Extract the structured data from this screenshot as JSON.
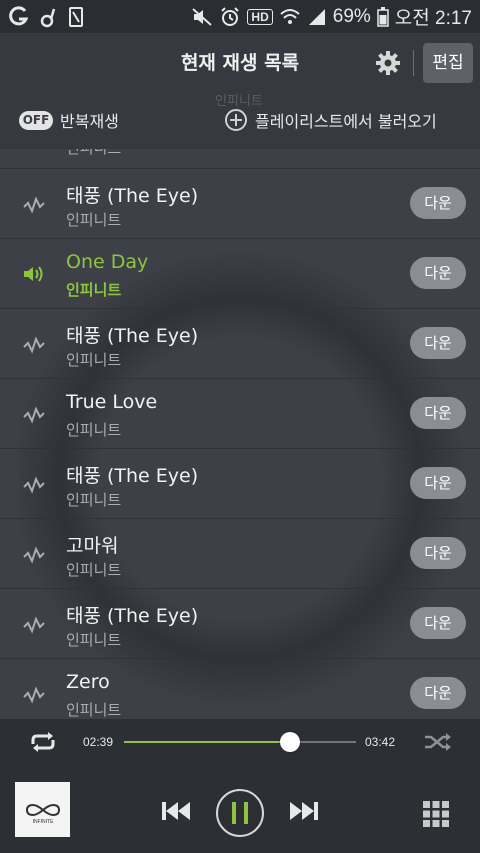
{
  "status_bar": {
    "battery": "69%",
    "time": "오전 2:17",
    "hd_label": "HD"
  },
  "header": {
    "title": "현재 재생 목록",
    "edit_label": "편집",
    "ghost_text": "인피니트"
  },
  "options": {
    "repeat_badge": "OFF",
    "repeat_label": "반복재생",
    "load_playlist_label": "플레이리스트에서 불러오기"
  },
  "playlist": {
    "partial_artist": "인피니트",
    "download_label": "다운",
    "items": [
      {
        "title": "태풍 (The Eye)",
        "artist": "인피니트",
        "playing": false
      },
      {
        "title": "One Day",
        "artist": "인피니트",
        "playing": true
      },
      {
        "title": "태풍 (The Eye)",
        "artist": "인피니트",
        "playing": false
      },
      {
        "title": "True Love",
        "artist": "인피니트",
        "playing": false
      },
      {
        "title": "태풍 (The Eye)",
        "artist": "인피니트",
        "playing": false
      },
      {
        "title": "고마워",
        "artist": "인피니트",
        "playing": false
      },
      {
        "title": "태풍 (The Eye)",
        "artist": "인피니트",
        "playing": false
      },
      {
        "title": "Zero",
        "artist": "인피니트",
        "playing": false
      }
    ]
  },
  "player": {
    "elapsed": "02:39",
    "duration": "03:42",
    "progress": 0.716,
    "album_art_text": "INFINITE"
  },
  "colors": {
    "accent": "#8cc63f",
    "background": "#3b3f45",
    "header": "#363a40",
    "player": "#2c2f34"
  }
}
